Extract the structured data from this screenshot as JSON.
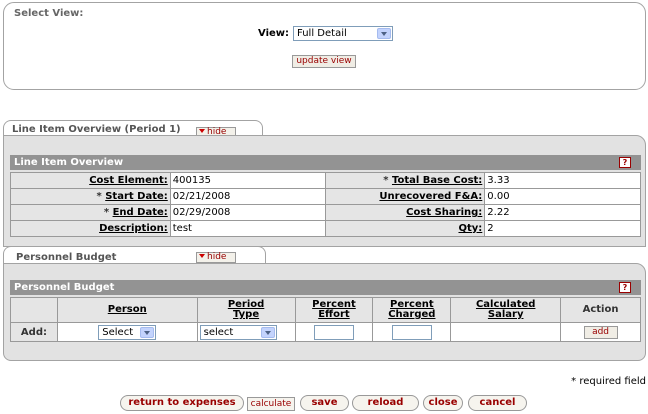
{
  "select_view": {
    "title": "Select View:",
    "view_label": "View:",
    "view_value": "Full Detail",
    "update_button": "update view"
  },
  "line_item_tab": {
    "title": "Line Item Overview (Period 1)",
    "hide_label": "hide",
    "header": "Line Item Overview",
    "help": "?",
    "fields": {
      "cost_element_label": "Cost Element:",
      "cost_element_value": "400135",
      "start_date_label": "Start Date:",
      "start_date_value": "02/21/2008",
      "end_date_label": "End Date:",
      "end_date_value": "02/29/2008",
      "description_label": "Description:",
      "description_value": "test",
      "total_base_cost_label": "Total Base Cost:",
      "total_base_cost_value": "3.33",
      "unrecovered_label": "Unrecovered F&A:",
      "unrecovered_value": "0.00",
      "cost_sharing_label": "Cost Sharing:",
      "cost_sharing_value": "2.22",
      "qty_label": "Qty:",
      "qty_value": "2",
      "required_mark": "*"
    }
  },
  "personnel_tab": {
    "title": "Personnel Budget",
    "hide_label": "hide",
    "header": "Personnel Budget",
    "help": "?",
    "columns": {
      "person": "Person",
      "period_type_1": "Period",
      "period_type_2": "Type",
      "percent_effort_1": "Percent",
      "percent_effort_2": "Effort",
      "percent_charged_1": "Percent",
      "percent_charged_2": "Charged",
      "calculated_salary_1": "Calculated",
      "calculated_salary_2": "Salary",
      "action": "Action"
    },
    "add_row": {
      "label": "Add:",
      "person_select": "Select",
      "period_type_select": "select",
      "add_button": "add"
    }
  },
  "required_note": "* required field",
  "bottom_buttons": {
    "return": "return to expenses",
    "calculate": "calculate",
    "save": "save",
    "reload": "reload",
    "close": "close",
    "cancel": "cancel"
  }
}
